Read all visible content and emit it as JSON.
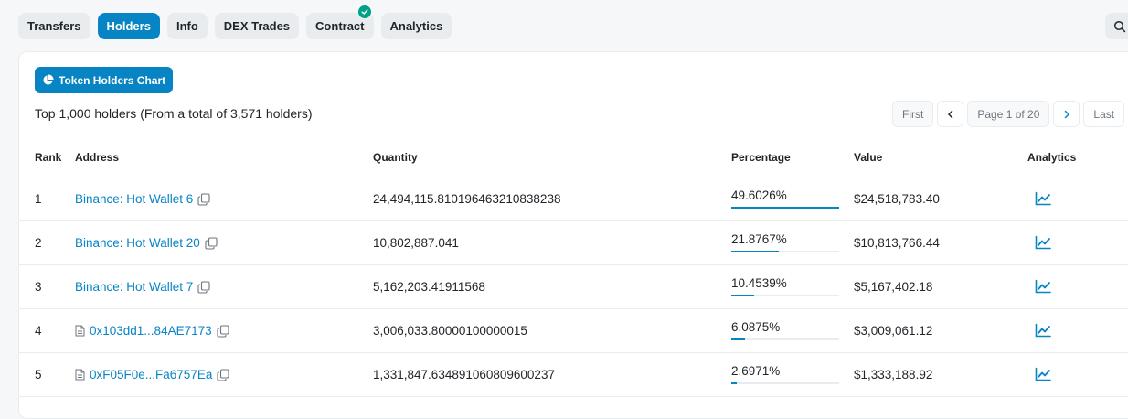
{
  "tabs": [
    {
      "label": "Transfers",
      "active": false
    },
    {
      "label": "Holders",
      "active": true
    },
    {
      "label": "Info",
      "active": false
    },
    {
      "label": "DEX Trades",
      "active": false
    },
    {
      "label": "Contract",
      "active": false,
      "verified": true
    },
    {
      "label": "Analytics",
      "active": false
    }
  ],
  "chart_button": {
    "label": "Token Holders Chart",
    "icon": "pie-chart-icon"
  },
  "summary": "Top 1,000 holders (From a total of 3,571 holders)",
  "pagination": {
    "first": "First",
    "page": "Page 1 of 20",
    "last": "Last"
  },
  "columns": {
    "rank": "Rank",
    "address": "Address",
    "quantity": "Quantity",
    "percentage": "Percentage",
    "value": "Value",
    "analytics": "Analytics"
  },
  "rows": [
    {
      "rank": "1",
      "address": "Binance: Hot Wallet 6",
      "contract": false,
      "quantity": "24,494,115.810196463210838238",
      "percentage": "49.6026%",
      "pct_fill": 100,
      "value": "$24,518,783.40"
    },
    {
      "rank": "2",
      "address": "Binance: Hot Wallet 20",
      "contract": false,
      "quantity": "10,802,887.041",
      "percentage": "21.8767%",
      "pct_fill": 44.1,
      "value": "$10,813,766.44"
    },
    {
      "rank": "3",
      "address": "Binance: Hot Wallet 7",
      "contract": false,
      "quantity": "5,162,203.41911568",
      "percentage": "10.4539%",
      "pct_fill": 21.1,
      "value": "$5,167,402.18"
    },
    {
      "rank": "4",
      "address": "0x103dd1...84AE7173",
      "contract": true,
      "quantity": "3,006,033.80000100000015",
      "percentage": "6.0875%",
      "pct_fill": 12.3,
      "value": "$3,009,061.12"
    },
    {
      "rank": "5",
      "address": "0xF05F0e...Fa6757Ea",
      "contract": true,
      "quantity": "1,331,847.634891060809600237",
      "percentage": "2.6971%",
      "pct_fill": 5.4,
      "value": "$1,333,188.92"
    }
  ],
  "colors": {
    "accent": "#0784c3",
    "verified": "#00a186"
  }
}
